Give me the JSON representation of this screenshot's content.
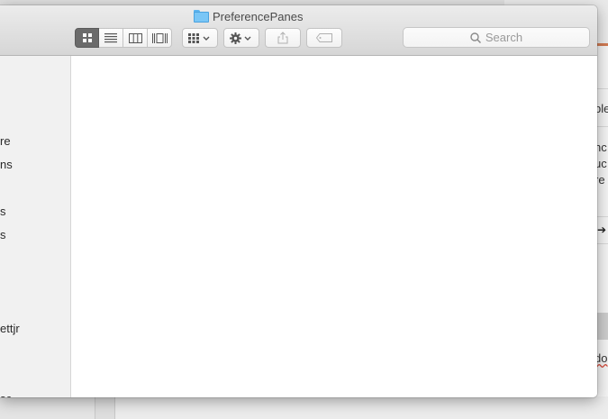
{
  "window": {
    "title": "PreferencePanes"
  },
  "toolbar": {
    "view_modes": [
      "icon-view",
      "list-view",
      "column-view",
      "cover-flow-view"
    ],
    "active_view": "icon-view",
    "arrange_icon": "arrange-grid-icon",
    "action_icon": "gear-icon",
    "share_icon": "share-icon",
    "tag_icon": "tag-icon",
    "search_placeholder": "Search"
  },
  "sidebar": {
    "items": [
      "re",
      "ns",
      "s",
      "s",
      "ettjr",
      "sc"
    ]
  },
  "background_window": {
    "fragments": [
      "ble",
      "nc",
      "uc",
      "re",
      "do"
    ]
  },
  "colors": {
    "accent": "#d07a52",
    "active_segment": "#6b6b6b",
    "folder": "#7ac6f6"
  }
}
